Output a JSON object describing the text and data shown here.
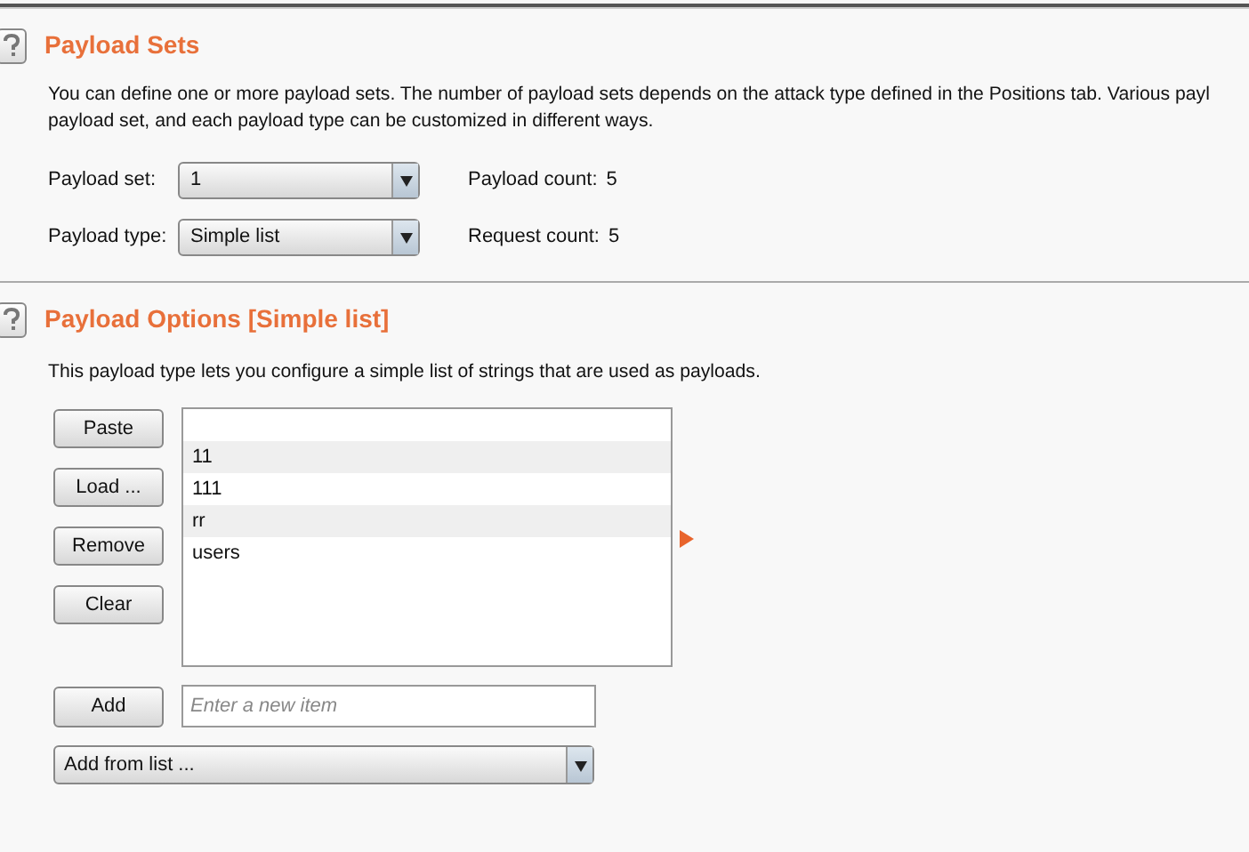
{
  "sections": [
    {
      "title": "Payload Sets",
      "description": [
        "You can define one or more payload sets. The number of payload sets depends on the attack type defined in the Positions tab. Various payl",
        "payload set, and each payload type can be customized in different ways."
      ]
    },
    {
      "title": "Payload Options [Simple list]",
      "description": [
        "This payload type lets you configure a simple list of strings that are used as payloads."
      ]
    }
  ],
  "settings": [
    {
      "label": "Payload set:",
      "value": "1",
      "count_label": "Payload count:",
      "count": "5"
    },
    {
      "label": "Payload type:",
      "value": "Simple list",
      "count_label": "Request count:",
      "count": "5"
    }
  ],
  "list_buttons": [
    "Paste",
    "Load ...",
    "Remove",
    "Clear"
  ],
  "list_items": [
    "11",
    "111",
    "rr",
    "users"
  ],
  "add_button": "Add",
  "new_item": {
    "placeholder": "Enter a new item"
  },
  "add_from_list": "Add from list ..."
}
